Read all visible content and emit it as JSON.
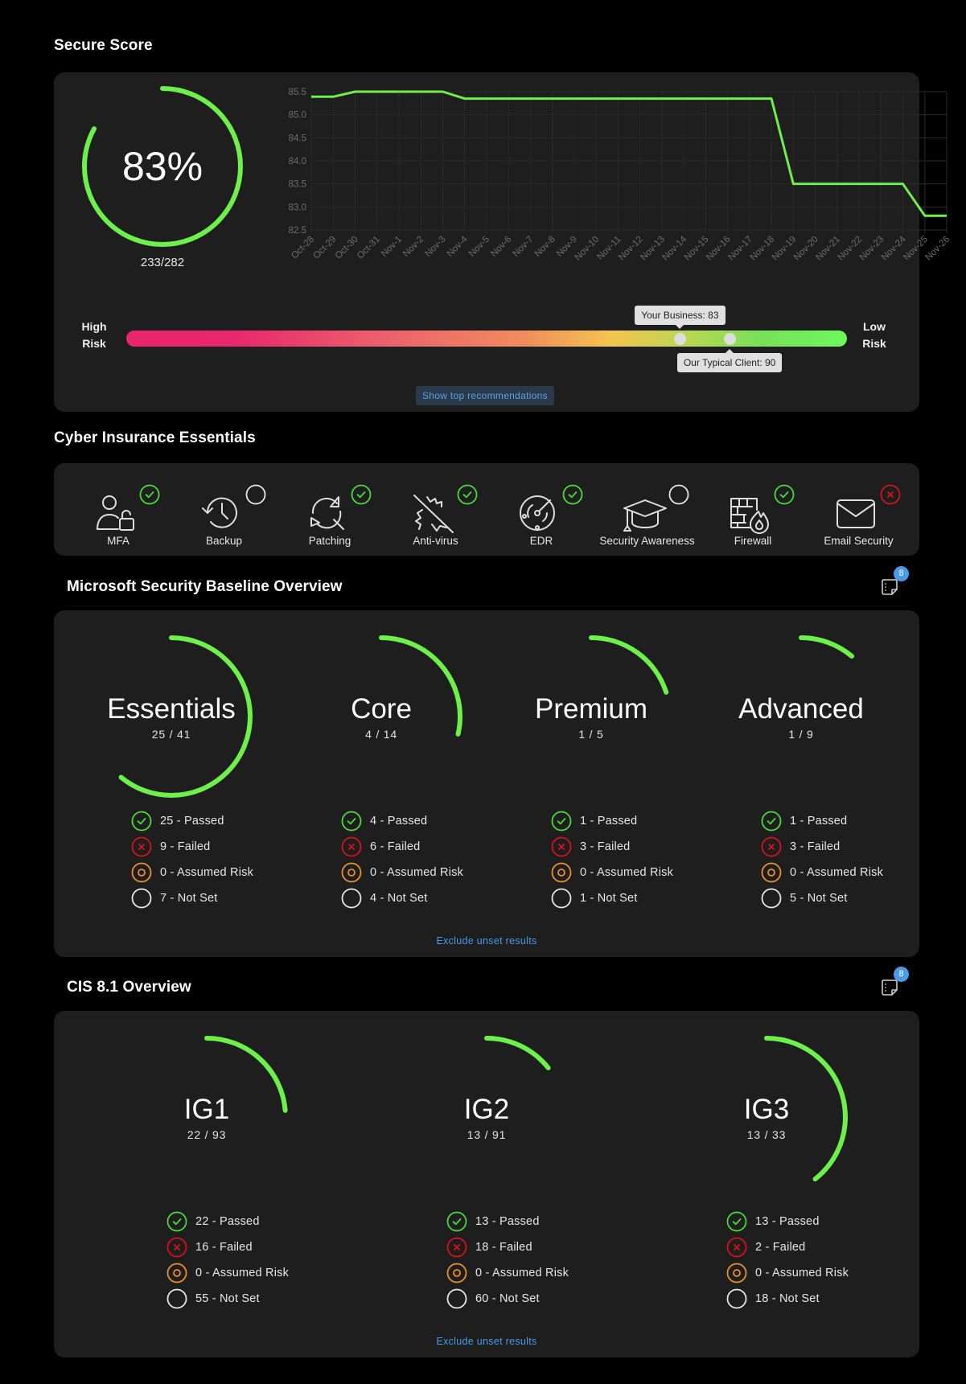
{
  "secure_score": {
    "title": "Secure Score",
    "percent_label": "83%",
    "percent": 83,
    "ratio_label": "233/282",
    "chart_data": {
      "type": "line",
      "title": "",
      "xlabel": "",
      "ylabel": "",
      "x": [
        "Oct-28",
        "Oct-29",
        "Oct-30",
        "Oct-31",
        "Nov-1",
        "Nov-2",
        "Nov-3",
        "Nov-4",
        "Nov-5",
        "Nov-6",
        "Nov-7",
        "Nov-8",
        "Nov-9",
        "Nov-10",
        "Nov-11",
        "Nov-12",
        "Nov-13",
        "Nov-14",
        "Nov-15",
        "Nov-16",
        "Nov-17",
        "Nov-18",
        "Nov-19",
        "Nov-20",
        "Nov-21",
        "Nov-22",
        "Nov-23",
        "Nov-24",
        "Nov-25",
        "Nov-26"
      ],
      "series": [
        {
          "name": "Secure Score",
          "color": "#6ef04a",
          "values": [
            85.39,
            85.39,
            85.5,
            85.5,
            85.5,
            85.5,
            85.5,
            85.35,
            85.35,
            85.35,
            85.35,
            85.35,
            85.35,
            85.35,
            85.35,
            85.35,
            85.35,
            85.35,
            85.35,
            85.35,
            85.35,
            85.35,
            83.5,
            83.5,
            83.5,
            83.5,
            83.5,
            83.5,
            82.81,
            82.81
          ]
        }
      ],
      "ylim": [
        82.5,
        85.5
      ],
      "yticks": [
        "85.5",
        "85.0",
        "84.5",
        "84.0",
        "83.5",
        "83.0",
        "82.5"
      ],
      "grid": true,
      "legend": "none"
    },
    "risk_bar": {
      "high_label_1": "High",
      "high_label_2": "Risk",
      "low_label_1": "Low",
      "low_label_2": "Risk",
      "your_business_label": "Your Business: 83",
      "your_business_value": 83,
      "typical_client_label": "Our Typical Client: 90",
      "typical_client_value": 90
    },
    "recommendations_button": "Show top recommendations"
  },
  "cyber_insurance": {
    "title": "Cyber Insurance Essentials",
    "items": [
      {
        "label": "MFA",
        "icon": "user-lock-icon",
        "status": "passed"
      },
      {
        "label": "Backup",
        "icon": "backup-history-icon",
        "status": "not-set"
      },
      {
        "label": "Patching",
        "icon": "patching-icon",
        "status": "passed"
      },
      {
        "label": "Anti-virus",
        "icon": "antivirus-icon",
        "status": "passed"
      },
      {
        "label": "EDR",
        "icon": "radar-icon",
        "status": "passed"
      },
      {
        "label": "Security Awareness",
        "icon": "graduation-cap-icon",
        "status": "not-set"
      },
      {
        "label": "Firewall",
        "icon": "firewall-icon",
        "status": "passed"
      },
      {
        "label": "Email Security",
        "icon": "envelope-icon",
        "status": "failed"
      }
    ]
  },
  "ms_baseline": {
    "title": "Microsoft Security Baseline Overview",
    "notes_badge": "8",
    "gauges": [
      {
        "name": "Essentials",
        "ratio": "25 / 41",
        "passed": 25,
        "total": 41,
        "legend": [
          "25 - Passed",
          "9 - Failed",
          "0 - Assumed Risk",
          "7 - Not Set"
        ]
      },
      {
        "name": "Core",
        "ratio": "4 / 14",
        "passed": 4,
        "total": 14,
        "legend": [
          "4 - Passed",
          "6 - Failed",
          "0 - Assumed Risk",
          "4 - Not Set"
        ]
      },
      {
        "name": "Premium",
        "ratio": "1 / 5",
        "passed": 1,
        "total": 5,
        "legend": [
          "1 - Passed",
          "3 - Failed",
          "0 - Assumed Risk",
          "1 - Not Set"
        ]
      },
      {
        "name": "Advanced",
        "ratio": "1 / 9",
        "passed": 1,
        "total": 9,
        "legend": [
          "1 - Passed",
          "3 - Failed",
          "0 - Assumed Risk",
          "5 - Not Set"
        ]
      }
    ],
    "exclude_link": "Exclude unset results"
  },
  "cis": {
    "title": "CIS 8.1 Overview",
    "notes_badge": "8",
    "gauges": [
      {
        "name": "IG1",
        "ratio": "22 / 93",
        "passed": 22,
        "total": 93,
        "legend": [
          "22 - Passed",
          "16 - Failed",
          "0 - Assumed Risk",
          "55 - Not Set"
        ]
      },
      {
        "name": "IG2",
        "ratio": "13 / 91",
        "passed": 13,
        "total": 91,
        "legend": [
          "13 - Passed",
          "18 - Failed",
          "0 - Assumed Risk",
          "60 - Not Set"
        ]
      },
      {
        "name": "IG3",
        "ratio": "13 / 33",
        "passed": 13,
        "total": 33,
        "legend": [
          "13 - Passed",
          "2 - Failed",
          "0 - Assumed Risk",
          "18 - Not Set"
        ]
      }
    ],
    "exclude_link": "Exclude unset results"
  },
  "colors": {
    "accent_green": "#6ef04a",
    "passed": "#4cd93c",
    "failed": "#d6121f",
    "assumed_risk": "#e8912d",
    "not_set": "#e6e6e6",
    "link_blue": "#4a9ae6"
  }
}
